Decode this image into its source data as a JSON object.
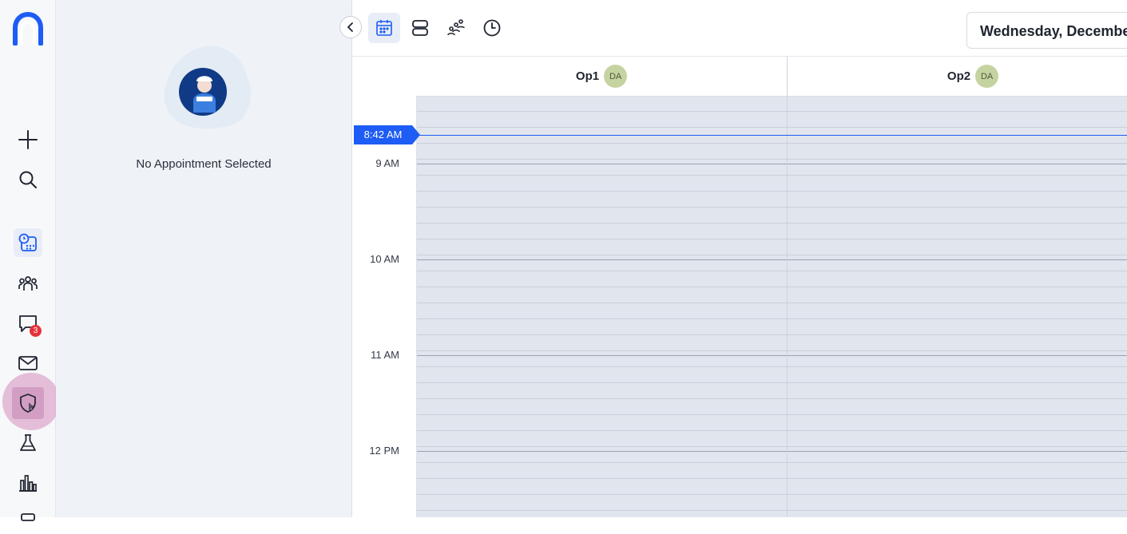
{
  "rail": {
    "logo_icon": "app-logo",
    "items": [
      {
        "name": "new-button",
        "icon": "plus-icon"
      },
      {
        "name": "search-button",
        "icon": "search-icon"
      },
      {
        "name": "schedule-button",
        "icon": "calendar-clock-icon",
        "active": true
      },
      {
        "name": "patients-button",
        "icon": "people-icon"
      },
      {
        "name": "messages-button",
        "icon": "chat-icon",
        "badge": "3"
      },
      {
        "name": "mail-button",
        "icon": "mail-icon"
      },
      {
        "name": "insurance-button",
        "icon": "shield-icon"
      },
      {
        "name": "lab-button",
        "icon": "flask-icon"
      },
      {
        "name": "reports-button",
        "icon": "bar-chart-icon"
      }
    ]
  },
  "panel": {
    "empty_text": "No Appointment Selected"
  },
  "toolbar": {
    "date_label": "Wednesday, December"
  },
  "schedule": {
    "current_time": "8:42 AM",
    "hours": [
      "9 AM",
      "10 AM",
      "11 AM",
      "12 PM"
    ],
    "columns": [
      {
        "name": "Op1",
        "provider": "DA"
      },
      {
        "name": "Op2",
        "provider": "DA"
      }
    ]
  }
}
